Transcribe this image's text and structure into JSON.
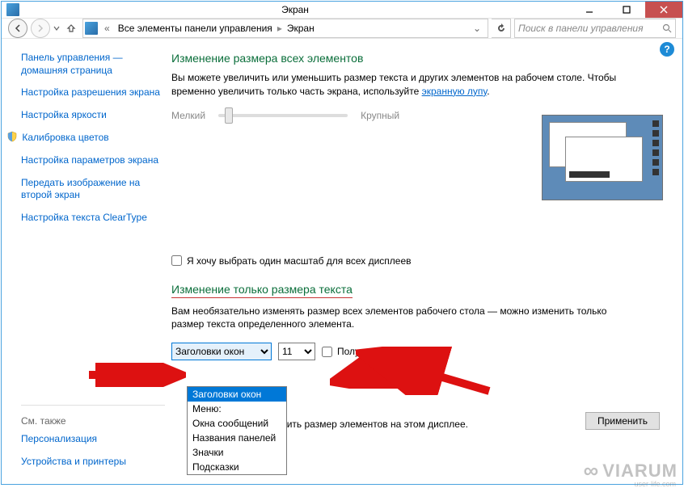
{
  "window": {
    "title": "Экран"
  },
  "titlebar_buttons": {
    "minimize": "minimize",
    "maximize": "maximize",
    "close": "close"
  },
  "breadcrumb": {
    "seg1": "Все элементы панели управления",
    "seg2": "Экран"
  },
  "search": {
    "placeholder": "Поиск в панели управления"
  },
  "sidebar": {
    "items": [
      "Панель управления — домашняя страница",
      "Настройка разрешения экрана",
      "Настройка яркости",
      "Калибровка цветов",
      "Настройка параметров экрана",
      "Передать изображение на второй экран",
      "Настройка текста ClearType"
    ],
    "see_also_label": "См. также",
    "see_also": [
      "Персонализация",
      "Устройства и принтеры"
    ]
  },
  "main": {
    "section1_title": "Изменение размера всех элементов",
    "section1_desc_pre": "Вы можете увеличить или уменьшить размер текста и других элементов на рабочем столе. Чтобы временно увеличить только часть экрана, используйте ",
    "section1_link": "экранную лупу",
    "section1_desc_post": ".",
    "slider_min": "Мелкий",
    "slider_max": "Крупный",
    "checkbox_custom": "Я хочу выбрать один масштаб для всех дисплеев",
    "section2_title": "Изменение только размера текста",
    "section2_desc": "Вам необязательно изменять размер всех элементов рабочего стола — можно изменить только размер текста определенного элемента.",
    "element_select_value": "Заголовки окон",
    "element_options": [
      "Заголовки окон",
      "Меню:",
      "Окна сообщений",
      "Названия панелей",
      "Значки",
      "Подсказки"
    ],
    "size_value": "11",
    "bold_label": "Полужирный",
    "info_text": "нить размер элементов на этом дисплее.",
    "apply_button": "Применить"
  },
  "watermark": {
    "brand": "VIARUM",
    "sub": "user-life.com"
  }
}
